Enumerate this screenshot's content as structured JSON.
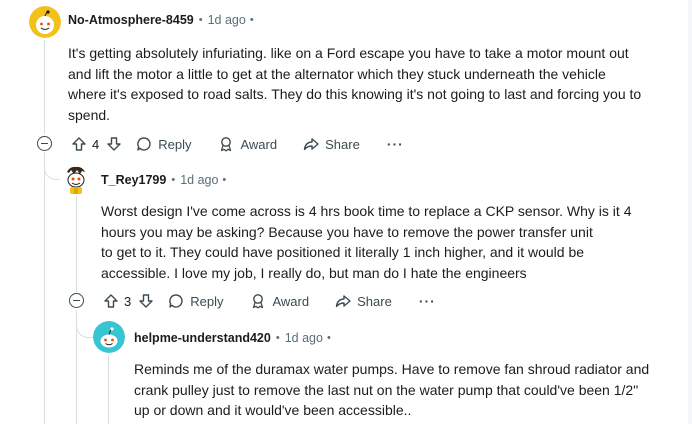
{
  "comments": [
    {
      "username": "No-Atmosphere-8459",
      "time": "1d ago",
      "body": [
        "It's getting absolutely infuriating. like on a Ford escape you have to take a motor mount out",
        "and lift the motor a little to get at the alternator which they stuck underneath the vehicle",
        "where it's exposed to road salts. They do this knowing it's not going to last and forcing you to",
        "spend."
      ],
      "votes": "4",
      "reply_label": "Reply",
      "award_label": "Award",
      "share_label": "Share",
      "more_label": "···"
    },
    {
      "username": "T_Rey1799",
      "time": "1d ago",
      "body": [
        "Worst design I've come across is 4 hrs book time to replace a CKP sensor. Why is it 4",
        "hours you may be asking? Because you have to remove the power transfer unit",
        "to get to it. They could have positioned it literally 1 inch higher, and it would be",
        "accessible. I love my job, I really do, but man do I hate the engineers"
      ],
      "votes": "3",
      "reply_label": "Reply",
      "award_label": "Award",
      "share_label": "Share",
      "more_label": "···"
    },
    {
      "username": "helpme-understand420",
      "time": "1d ago",
      "body": [
        "Reminds me of the duramax water pumps. Have to remove fan shroud radiator and",
        "crank pulley just to remove the last nut on the water pump that could've been 1/2\"",
        "up or down and it would've been accessible.."
      ]
    }
  ],
  "separator": "•",
  "colors": {
    "avatar_yellow": "#f2c21b",
    "avatar_teal": "#37c5d2",
    "thread_line": "#d9dde0",
    "meta_gray": "#576f76"
  }
}
